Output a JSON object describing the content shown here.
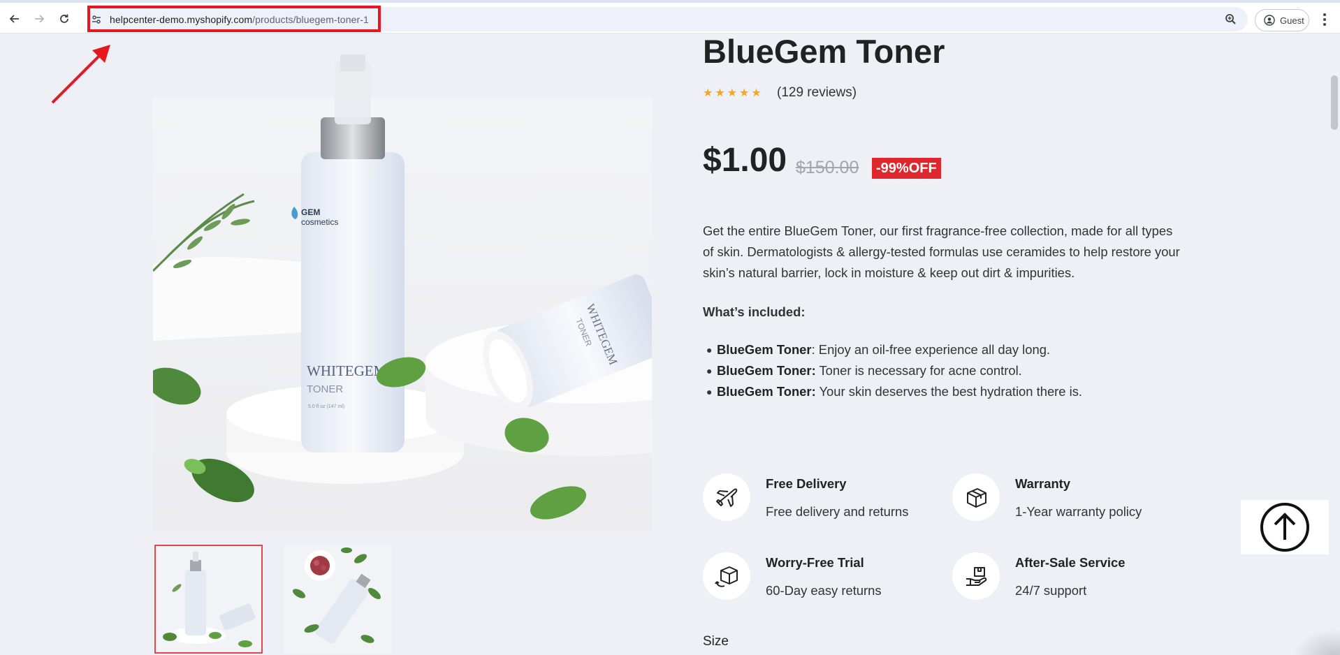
{
  "browser": {
    "url_host": "helpcenter-demo.myshopify.com",
    "url_path": "/products/bluegem-toner-1",
    "profile_label": "Guest"
  },
  "gallery": {
    "main_image": {
      "brand_line1": "GEM",
      "brand_line2": "cosmetics",
      "bottle_name": "WHITEGEM",
      "bottle_sub": "TONER",
      "bottle_volume": "5.0 fl oz (147 ml)"
    },
    "thumbnails": [
      {
        "label": "Toner bottle thumbnail",
        "selected": true
      },
      {
        "label": "Toner with rose thumbnail",
        "selected": false
      }
    ]
  },
  "product": {
    "title": "BlueGem Toner",
    "rating": 5,
    "reviews": "(129 reviews)",
    "price": "$1.00",
    "compare_price": "$150.00",
    "discount_badge": "-99%OFF",
    "description": "Get the entire BlueGem Toner, our first fragrance-free collection, made for all types of skin. Dermatologists & allergy-tested formulas use ceramides to help restore your skin’s natural barrier, lock in moisture & keep out dirt & impurities.",
    "included_heading": "What’s included:",
    "included": [
      {
        "name": "BlueGem Toner",
        "text": ": Enjoy an oil-free experience all day long."
      },
      {
        "name": "BlueGem Toner:",
        "text": " Toner is necessary for acne control."
      },
      {
        "name": "BlueGem Toner:",
        "text": " Your skin deserves the best hydration there is."
      }
    ],
    "size_label": "Size"
  },
  "features": [
    {
      "icon": "airplane-icon",
      "title": "Free Delivery",
      "subtitle": "Free delivery and returns"
    },
    {
      "icon": "box-icon",
      "title": "Warranty",
      "subtitle": "1-Year warranty policy"
    },
    {
      "icon": "return-box-icon",
      "title": "Worry-Free Trial",
      "subtitle": "60-Day easy returns"
    },
    {
      "icon": "hand-box-icon",
      "title": "After-Sale Service",
      "subtitle": "24/7 support"
    }
  ],
  "colors": {
    "page_bg": "#eef0f6",
    "discount_bg": "#e0262d",
    "star": "#f5a623",
    "annotation": "#e8171f"
  }
}
